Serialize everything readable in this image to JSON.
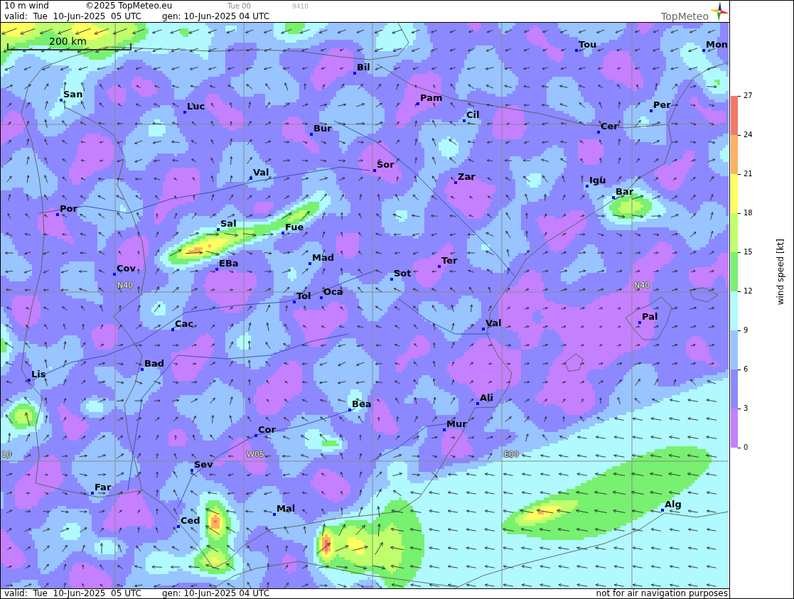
{
  "header": {
    "title": "10 m wind",
    "copyright": "©2025 TopMeteo.eu",
    "run": "Tue 00",
    "code": "9410",
    "valid": "valid:  Tue  10-Jun-2025  05 UTC",
    "generated": "gen: 10-Jun-2025 04 UTC",
    "logo": "TopMeteo"
  },
  "map": {
    "scale": "200 km",
    "grid_labels": [
      "N40",
      "N40",
      "10",
      "W05",
      "E00"
    ],
    "places": [
      "Tou",
      "Mon",
      "Bil",
      "San",
      "Pam",
      "Per",
      "Luc",
      "Cil",
      "Cer",
      "Bur",
      "Sor",
      "Val",
      "Zar",
      "Igu",
      "Bar",
      "Por",
      "Sal",
      "Fue",
      "Mad",
      "EBa",
      "Ter",
      "Cov",
      "Sot",
      "Oca",
      "Tol",
      "Pal",
      "Cac",
      "Val",
      "Bad",
      "Lis",
      "Ali",
      "Bea",
      "Mur",
      "Cor",
      "Sev",
      "Far",
      "Alg",
      "Mal",
      "Ced"
    ]
  },
  "legend": {
    "title": "wind speed [kt]",
    "ticks": [
      "27",
      "24",
      "21",
      "18",
      "15",
      "12",
      "9",
      "6",
      "3",
      "0"
    ],
    "bands": [
      {
        "color": "#f07868"
      },
      {
        "color": "#ffb060"
      },
      {
        "color": "#ffff60"
      },
      {
        "color": "#c0ff6c"
      },
      {
        "color": "#78f070"
      },
      {
        "color": "#b0faff"
      },
      {
        "color": "#98c4ff"
      },
      {
        "color": "#8c88ff"
      },
      {
        "color": "#c480ff"
      }
    ]
  },
  "footer": {
    "valid": "valid:  Tue  10-Jun-2025  05 UTC",
    "generated": "gen: 10-Jun-2025 04 UTC",
    "note": "not for air navigation purposes"
  }
}
